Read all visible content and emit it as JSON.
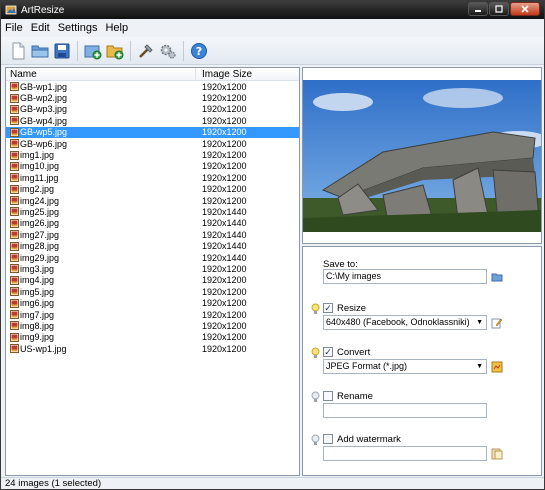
{
  "window": {
    "title": "ArtResize"
  },
  "menu": {
    "items": [
      "File",
      "Edit",
      "Settings",
      "Help"
    ]
  },
  "toolbar": {
    "buttons": [
      "new-file-icon",
      "open-folder-icon",
      "save-icon",
      "add-images-icon",
      "add-folder-icon",
      "tools-icon",
      "settings-icon",
      "help-icon"
    ]
  },
  "filelist": {
    "columns": [
      "Name",
      "Image Size"
    ],
    "rows": [
      {
        "name": "GB-wp1.jpg",
        "size": "1920x1200"
      },
      {
        "name": "GB-wp2.jpg",
        "size": "1920x1200"
      },
      {
        "name": "GB-wp3.jpg",
        "size": "1920x1200"
      },
      {
        "name": "GB-wp4.jpg",
        "size": "1920x1200"
      },
      {
        "name": "GB-wp5.jpg",
        "size": "1920x1200",
        "selected": true
      },
      {
        "name": "GB-wp6.jpg",
        "size": "1920x1200"
      },
      {
        "name": "img1.jpg",
        "size": "1920x1200"
      },
      {
        "name": "img10.jpg",
        "size": "1920x1200"
      },
      {
        "name": "img11.jpg",
        "size": "1920x1200"
      },
      {
        "name": "img2.jpg",
        "size": "1920x1200"
      },
      {
        "name": "img24.jpg",
        "size": "1920x1200"
      },
      {
        "name": "img25.jpg",
        "size": "1920x1440"
      },
      {
        "name": "img26.jpg",
        "size": "1920x1440"
      },
      {
        "name": "img27.jpg",
        "size": "1920x1440"
      },
      {
        "name": "img28.jpg",
        "size": "1920x1440"
      },
      {
        "name": "img29.jpg",
        "size": "1920x1440"
      },
      {
        "name": "img3.jpg",
        "size": "1920x1200"
      },
      {
        "name": "img4.jpg",
        "size": "1920x1200"
      },
      {
        "name": "img5.jpg",
        "size": "1920x1200"
      },
      {
        "name": "img6.jpg",
        "size": "1920x1200"
      },
      {
        "name": "img7.jpg",
        "size": "1920x1200"
      },
      {
        "name": "img8.jpg",
        "size": "1920x1200"
      },
      {
        "name": "img9.jpg",
        "size": "1920x1200"
      },
      {
        "name": "US-wp1.jpg",
        "size": "1920x1200"
      }
    ]
  },
  "settings": {
    "save_to_label": "Save to:",
    "save_to_value": "C:\\My images",
    "resize_label": "Resize",
    "resize_checked": true,
    "resize_value": "640x480 (Facebook, Odnoklassniki)",
    "convert_label": "Convert",
    "convert_checked": true,
    "convert_value": "JPEG Format (*.jpg)",
    "rename_label": "Rename",
    "rename_checked": false,
    "rename_value": "",
    "watermark_label": "Add watermark",
    "watermark_checked": false,
    "watermark_value": ""
  },
  "status": {
    "text": "24 images (1 selected)"
  },
  "colors": {
    "selection": "#3399ff",
    "accent": "#2a6fd6"
  }
}
